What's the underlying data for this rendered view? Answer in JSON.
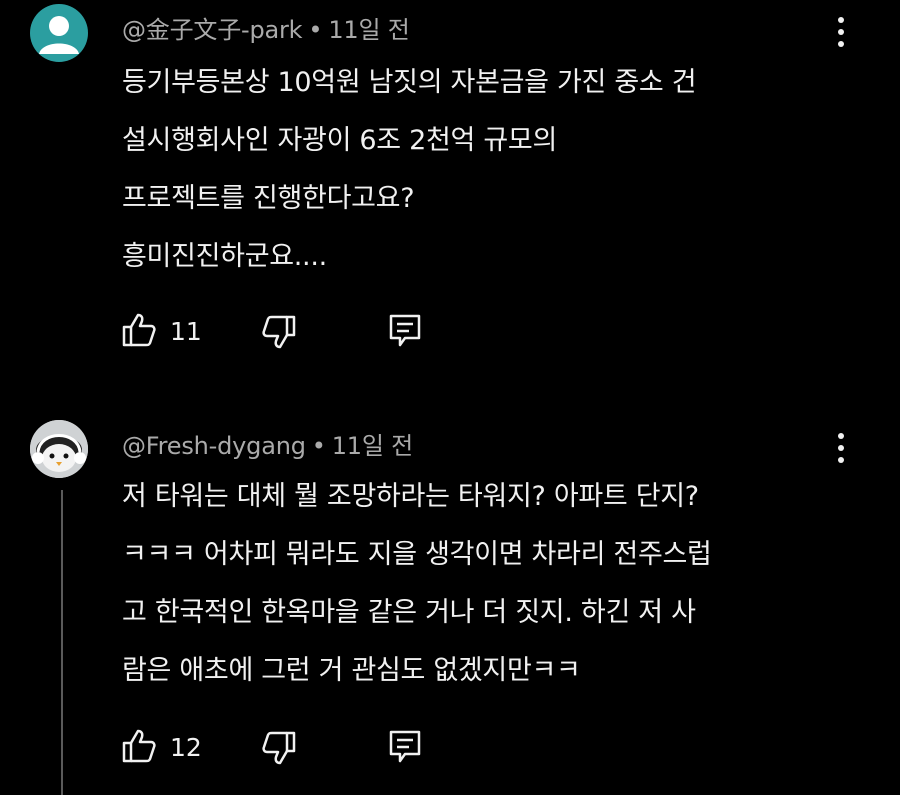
{
  "comments": [
    {
      "handle": "@金子文子-park",
      "separator": "•",
      "time": "11일 전",
      "lines": [
        "등기부등본상  10억원 남짓의 자본금을 가진 중소 건",
        "설시행회사인 자광이 6조 2천억 규모의",
        "프로젝트를 진행한다고요?",
        "흥미진진하군요...."
      ],
      "likes": "11",
      "avatar_color": "#2b9ea0"
    },
    {
      "handle": "@Fresh-dygang",
      "separator": "•",
      "time": "11일 전",
      "lines": [
        "저 타워는 대체 뭘 조망하라는 타워지? 아파트 단지?",
        "ㅋㅋㅋ 어차피 뭐라도 지을 생각이면 차라리 전주스럽",
        "고 한국적인 한옥마을 같은 거나 더 짓지. 하긴 저 사",
        "람은 애초에 그런 거 관심도 없겠지만ㅋㅋ"
      ],
      "likes": "12"
    }
  ],
  "icons": {
    "like": "thumb-up-icon",
    "dislike": "thumb-down-icon",
    "reply": "reply-icon",
    "more": "more-vert-icon"
  }
}
